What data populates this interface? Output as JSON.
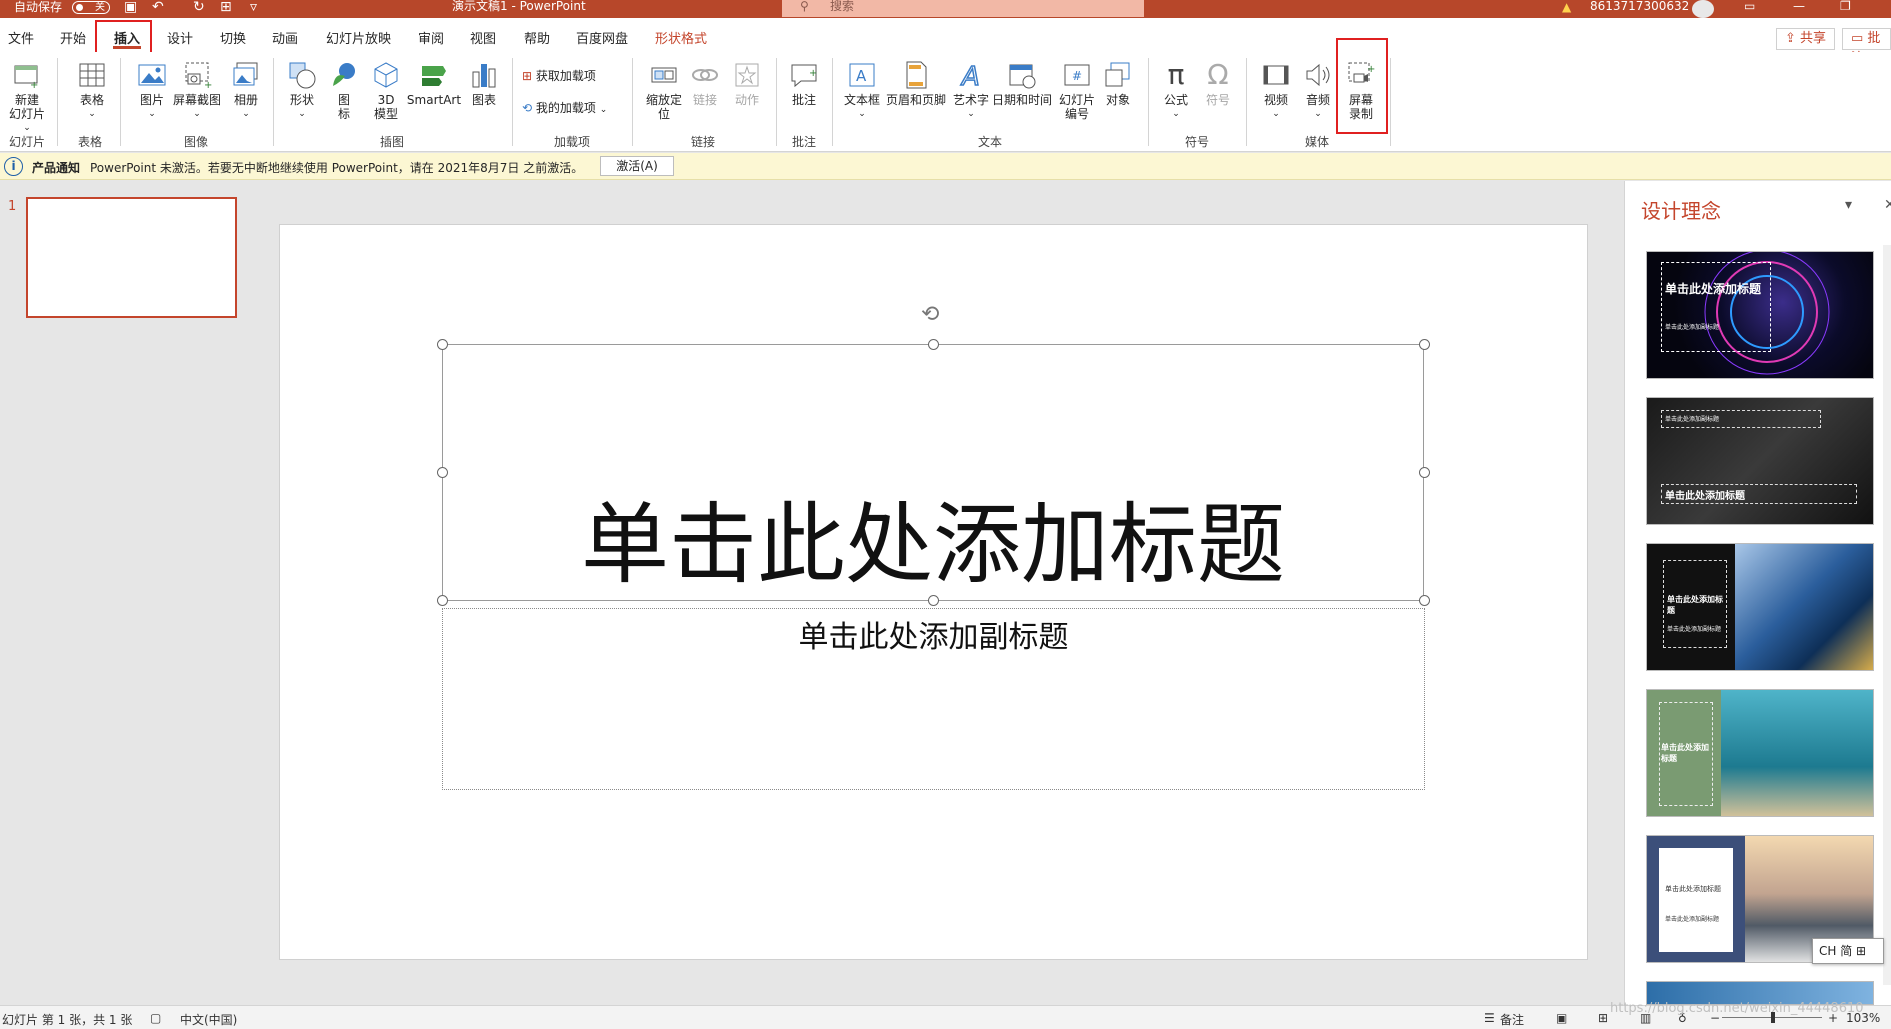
{
  "titlebar": {
    "autosave_label": "自动保存",
    "autosave_state": "关",
    "doc_title": "演示文稿1  -  PowerPoint",
    "search_placeholder": "搜索",
    "account": "8613717300632"
  },
  "tabs": [
    "文件",
    "开始",
    "插入",
    "设计",
    "切换",
    "动画",
    "幻灯片放映",
    "审阅",
    "视图",
    "帮助",
    "百度网盘",
    "形状格式"
  ],
  "active_tab": "插入",
  "share": {
    "share_label": "共享",
    "comment_label": "批注"
  },
  "ribbon": {
    "new_slide": "新建\n幻灯片",
    "table": "表格",
    "picture": "图片",
    "screenshot": "屏幕截图",
    "album": "相册",
    "shapes": "形状",
    "icons": "图\n标",
    "model3d": "3D\n模型",
    "smartart": "SmartArt",
    "chart": "图表",
    "get_addins": "获取加载项",
    "my_addins": "我的加载项",
    "zoom": "缩放定\n位",
    "link": "链接",
    "action": "动作",
    "comment": "批注",
    "textbox": "文本框",
    "header_footer": "页眉和页脚",
    "wordart": "艺术字",
    "datetime": "日期和时间",
    "slide_number": "幻灯片\n编号",
    "object": "对象",
    "equation": "公式",
    "symbol": "符号",
    "video": "视频",
    "audio": "音频",
    "screen_record": "屏幕\n录制",
    "groups": {
      "slides": "幻灯片",
      "tables": "表格",
      "images": "图像",
      "illustrations": "插图",
      "addins": "加载项",
      "links": "链接",
      "comments": "批注",
      "text": "文本",
      "symbols": "符号",
      "media": "媒体"
    }
  },
  "notification": {
    "title": "产品通知",
    "message": "PowerPoint 未激活。若要无中断地继续使用 PowerPoint，请在 2021年8月7日 之前激活。",
    "button": "激活(A)"
  },
  "thumbnails": {
    "number": "1"
  },
  "slide": {
    "title": "单击此处添加标题",
    "subtitle": "单击此处添加副标题"
  },
  "design_pane": {
    "title": "设计理念",
    "cards": [
      {
        "title": "单击此处添加标题",
        "sub": "单击此处添加副标题"
      },
      {
        "title": "单击此处添加标题",
        "sub": "单击此处添加副标题"
      },
      {
        "title": "单击此处添加标题",
        "sub": "单击此处添加副标题"
      },
      {
        "title": "单击此处添加标题",
        "sub": ""
      },
      {
        "title": "单击此处添加标题",
        "sub": "单击此处添加副标题"
      }
    ]
  },
  "ime": {
    "label": "CH 简"
  },
  "statusbar": {
    "slide_info": "幻灯片 第 1 张，共 1 张",
    "language": "中文(中国)",
    "notes": "备注",
    "zoom": "103%",
    "watermark": "https://blog.csdn.net/weixin_44448610"
  }
}
